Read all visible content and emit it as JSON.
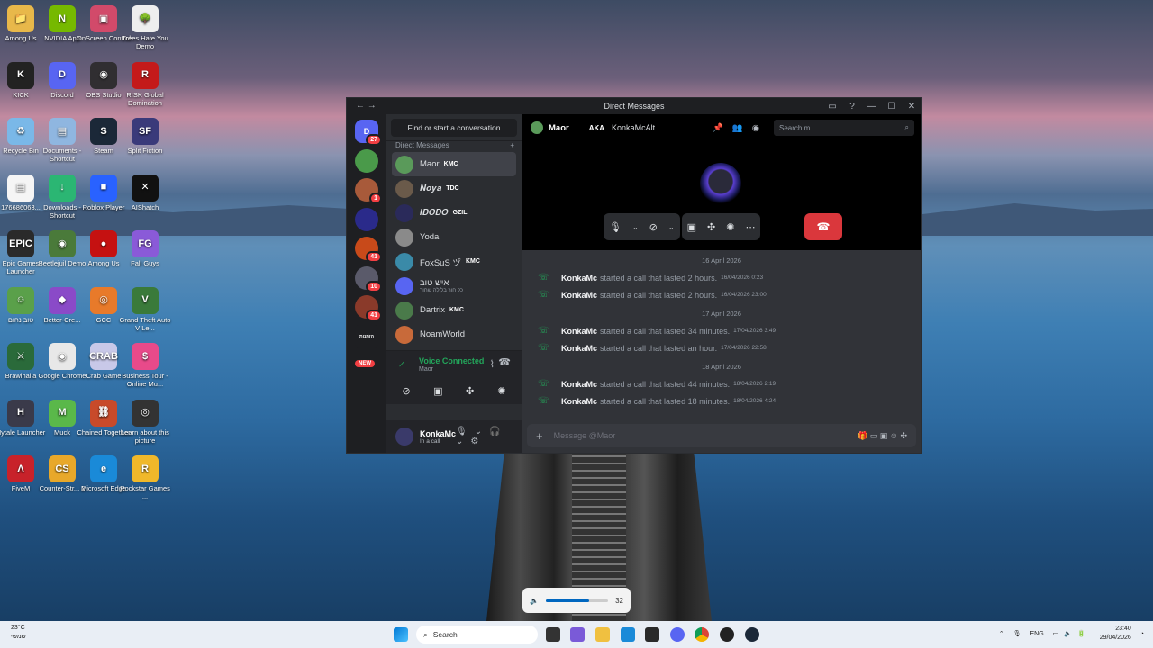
{
  "desktop": {
    "icons": [
      {
        "label": "Among Us",
        "glyph": "📁",
        "bg": "#e8b84a"
      },
      {
        "label": "NVIDIA App",
        "glyph": "N",
        "bg": "#76b900"
      },
      {
        "label": "OnScreen Control",
        "glyph": "▣",
        "bg": "#d24a6a"
      },
      {
        "label": "Trees Hate You Demo",
        "glyph": "🌳",
        "bg": "#eeeeee"
      },
      {
        "label": "KICK",
        "glyph": "K",
        "bg": "#222"
      },
      {
        "label": "Discord",
        "glyph": "D",
        "bg": "#5865f2"
      },
      {
        "label": "OBS Studio",
        "glyph": "◉",
        "bg": "#302e31"
      },
      {
        "label": "RISK Global Domination",
        "glyph": "R",
        "bg": "#c41a1a"
      },
      {
        "label": "Recycle Bin",
        "glyph": "♻",
        "bg": "#7ab8e8"
      },
      {
        "label": "Documents - Shortcut",
        "glyph": "▤",
        "bg": "#8fb6e0"
      },
      {
        "label": "Steam",
        "glyph": "S",
        "bg": "#1b2838"
      },
      {
        "label": "Split Fiction",
        "glyph": "SF",
        "bg": "#3a3a7a"
      },
      {
        "label": "176686063...",
        "glyph": "▤",
        "bg": "#f5f5f5"
      },
      {
        "label": "Downloads - Shortcut",
        "glyph": "↓",
        "bg": "#2bb673"
      },
      {
        "label": "Roblox Player",
        "glyph": "■",
        "bg": "#2962ff"
      },
      {
        "label": "AIShatch",
        "glyph": "✕",
        "bg": "#111"
      },
      {
        "label": "Epic Games Launcher",
        "glyph": "EPIC",
        "bg": "#2a2a2a"
      },
      {
        "label": "Beetlejuil Demo",
        "glyph": "◉",
        "bg": "#4a7a3a"
      },
      {
        "label": "Among Us",
        "glyph": "●",
        "bg": "#c51111"
      },
      {
        "label": "Fall Guys",
        "glyph": "FG",
        "bg": "#8a5ad8"
      },
      {
        "label": "טוב נחום",
        "glyph": "☺",
        "bg": "#5aa04a"
      },
      {
        "label": "Better-Cre...",
        "glyph": "◆",
        "bg": "#8a4ac8"
      },
      {
        "label": "GCC",
        "glyph": "◎",
        "bg": "#e87a2a"
      },
      {
        "label": "Grand Theft Auto V Le...",
        "glyph": "V",
        "bg": "#3a7a3a"
      },
      {
        "label": "Brawlhalla",
        "glyph": "⚔",
        "bg": "#2a6a3a"
      },
      {
        "label": "Google Chrome",
        "glyph": "◉",
        "bg": "#e8e8e8"
      },
      {
        "label": "Crab Game",
        "glyph": "CRAB",
        "bg": "#c8c8e8"
      },
      {
        "label": "Business Tour - Online Mu...",
        "glyph": "$",
        "bg": "#e84a8a"
      },
      {
        "label": "Hytale Launcher",
        "glyph": "H",
        "bg": "#3a3a4a"
      },
      {
        "label": "Muck",
        "glyph": "M",
        "bg": "#5ab84a"
      },
      {
        "label": "Chained Together",
        "glyph": "⛓",
        "bg": "#c84a2a"
      },
      {
        "label": "Learn about this picture",
        "glyph": "◎",
        "bg": "#333"
      },
      {
        "label": "FiveM",
        "glyph": "Λ",
        "bg": "#c8222a"
      },
      {
        "label": "Counter-Str... 2",
        "glyph": "CS",
        "bg": "#e8a82a"
      },
      {
        "label": "Microsoft Edge",
        "glyph": "e",
        "bg": "#1a8ad8"
      },
      {
        "label": "Rockstar Games ...",
        "glyph": "R",
        "bg": "#f0b82a"
      }
    ]
  },
  "discord": {
    "window_title": "Direct Messages",
    "find_placeholder": "Find or start a conversation",
    "dm_header": "Direct Messages",
    "dm_add": "+",
    "servers": [
      {
        "badge": "27",
        "bg": "#5865f2",
        "glyph": "D"
      },
      {
        "badge": "",
        "bg": "#4a9a4a",
        "glyph": ""
      },
      {
        "badge": "1",
        "bg": "#a85a3a",
        "glyph": ""
      },
      {
        "badge": "",
        "bg": "#2a2a8a",
        "glyph": ""
      },
      {
        "badge": "41",
        "bg": "#c84a1a",
        "glyph": ""
      },
      {
        "badge": "10",
        "bg": "#5a5a6a",
        "glyph": ""
      },
      {
        "badge": "41",
        "bg": "#8a3a2a",
        "glyph": ""
      },
      {
        "badge": "",
        "bg": "#1e1f22",
        "glyph": "הזמנות"
      }
    ],
    "new_label": "NEW",
    "dms": [
      {
        "name": "Maor",
        "tag": "KMC",
        "sub": "",
        "bg": "#5a9a5a"
      },
      {
        "name": "𝑵𝒐𝒚𝒂",
        "tag": "TDC",
        "sub": "",
        "bg": "#6a5a4a"
      },
      {
        "name": "𝑰𝑫𝑶𝑫𝑶",
        "tag": "GZIL",
        "sub": "",
        "bg": "#2a2a5a"
      },
      {
        "name": "Yoda",
        "tag": "",
        "sub": "",
        "bg": "#8a8a8a"
      },
      {
        "name": "FoxSuS ヅ",
        "tag": "KMC",
        "sub": "",
        "bg": "#3a8aa8"
      },
      {
        "name": "איש טוב",
        "tag": "",
        "sub": "כל חור בלילה שחור",
        "bg": "#5865f2"
      },
      {
        "name": "Dartrix",
        "tag": "KMC",
        "sub": "",
        "bg": "#4a7a4a"
      },
      {
        "name": "NoamWorld",
        "tag": "",
        "sub": "",
        "bg": "#c86a3a"
      }
    ],
    "voice": {
      "status": "Voice Connected",
      "channel": "Maor"
    },
    "user": {
      "name": "KonkaMc",
      "status": "In a call"
    },
    "chat": {
      "name": "Maor",
      "aka_label": "AKA",
      "aka_name": "KonkaMcAlt",
      "search_placeholder": "Search m...",
      "composer_placeholder": "Message @Maor"
    },
    "days": [
      {
        "date": "16 April 2026",
        "msgs": [
          {
            "user": "KonkaMc",
            "text": "started a call that lasted 2 hours.",
            "ts": "16/04/2026 0:23"
          },
          {
            "user": "KonkaMc",
            "text": "started a call that lasted 2 hours.",
            "ts": "16/04/2026 23:00"
          }
        ]
      },
      {
        "date": "17 April 2026",
        "msgs": [
          {
            "user": "KonkaMc",
            "text": "started a call that lasted 34 minutes.",
            "ts": "17/04/2026 3:49"
          },
          {
            "user": "KonkaMc",
            "text": "started a call that lasted an hour.",
            "ts": "17/04/2026 22:58"
          }
        ]
      },
      {
        "date": "18 April 2026",
        "msgs": [
          {
            "user": "KonkaMc",
            "text": "started a call that lasted 44 minutes.",
            "ts": "18/04/2026 2:19"
          },
          {
            "user": "KonkaMc",
            "text": "started a call that lasted 18 minutes.",
            "ts": "18/04/2026 4:24"
          }
        ]
      }
    ]
  },
  "volume": {
    "value": "32",
    "level": 0.7
  },
  "taskbar": {
    "weather_temp": "23°C",
    "weather_desc": "שמשי",
    "search_label": "Search",
    "lang": "ENG",
    "time": "23:40",
    "date": "29/04/2026"
  }
}
